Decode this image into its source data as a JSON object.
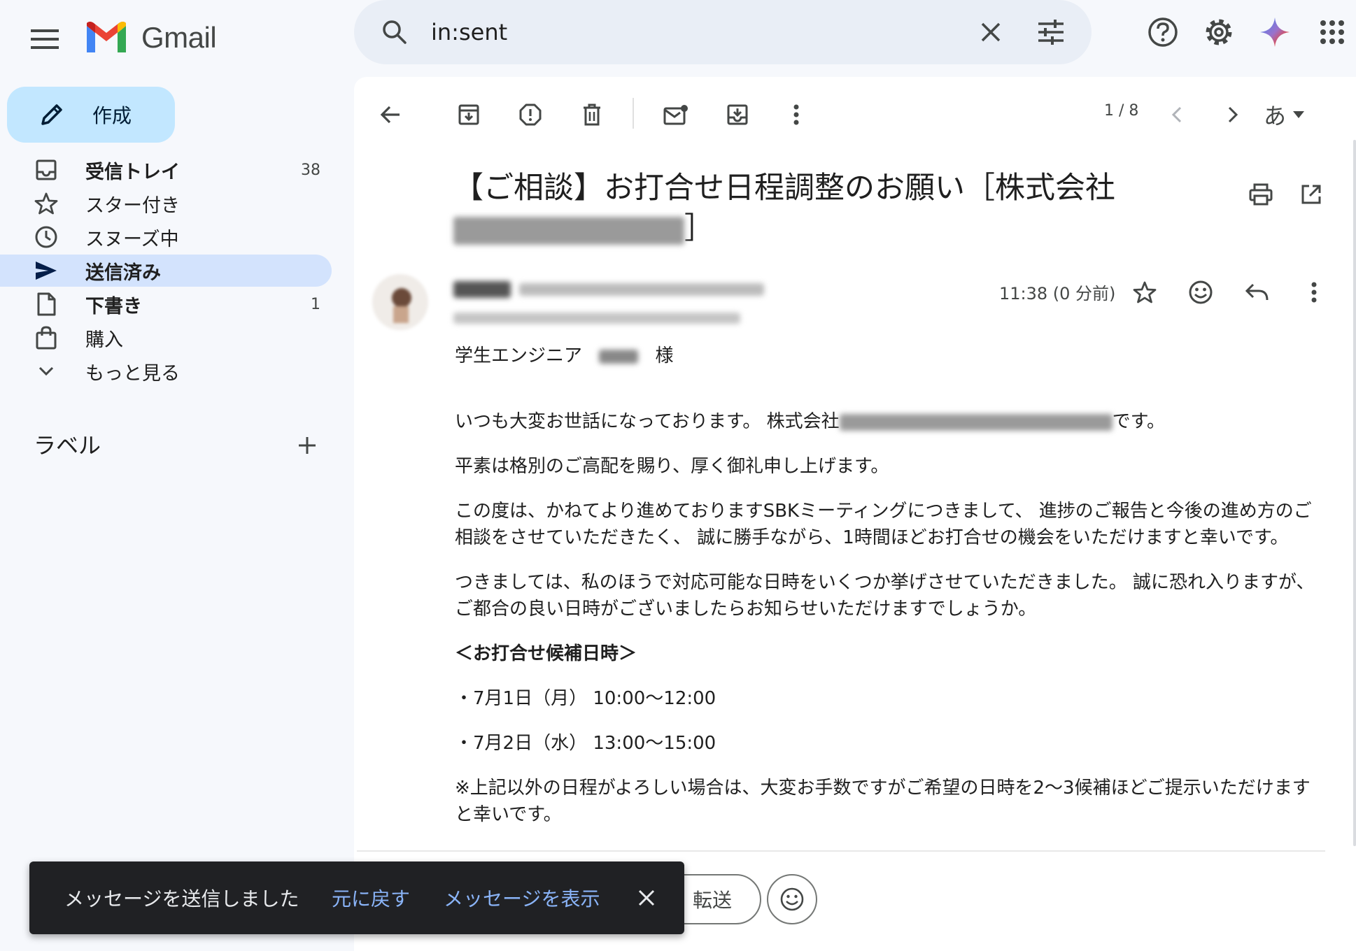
{
  "app": {
    "name": "Gmail"
  },
  "search": {
    "value": "in:sent"
  },
  "compose": {
    "label": "作成"
  },
  "sidebar": {
    "items": [
      {
        "label": "受信トレイ",
        "count": "38",
        "icon": "inbox-icon",
        "bold": true
      },
      {
        "label": "スター付き",
        "count": "",
        "icon": "star-icon",
        "bold": false
      },
      {
        "label": "スヌーズ中",
        "count": "",
        "icon": "clock-icon",
        "bold": false
      },
      {
        "label": "送信済み",
        "count": "",
        "icon": "send-icon",
        "bold": true,
        "active": true
      },
      {
        "label": "下書き",
        "count": "1",
        "icon": "draft-icon",
        "bold": true
      },
      {
        "label": "購入",
        "count": "",
        "icon": "shopping-bag-icon",
        "bold": false
      },
      {
        "label": "もっと見る",
        "count": "",
        "icon": "chevron-down-icon",
        "bold": false
      }
    ],
    "labels_title": "ラベル"
  },
  "toolbar": {
    "pager": "1 / 8",
    "lang": "あ"
  },
  "email": {
    "subject_line1": "【ご相談】お打合せ日程調整のお願い［株式会社",
    "subject_end": "］",
    "time": "11:38 (0 分前)",
    "salutation_prefix": "学生エンジニア",
    "salutation_suffix": "様",
    "greeting_prefix": "いつも大変お世話になっております。 株式会社",
    "greeting_suffix": "です。",
    "paragraphs": [
      "平素は格別のご高配を賜り、厚く御礼申し上げます。",
      "この度は、かねてより進めておりますSBKミーティングにつきまして、 進捗のご報告と今後の進め方のご相談をさせていただきたく、 誠に勝手ながら、1時間ほどお打合せの機会をいただけますと幸いです。",
      "つきましては、私のほうで対応可能な日時をいくつか挙げさせていただきました。 誠に恐れ入りますが、ご都合の良い日時がございましたらお知らせいただけますでしょうか。"
    ],
    "schedule_heading": "＜お打合せ候補日時＞",
    "slot1": "・7月1日（月） 10:00〜12:00",
    "slot2": "・7月2日（水） 13:00〜15:00",
    "note": "※上記以外の日程がよろしい場合は、大変お手数ですがご希望の日時を2〜3候補ほどご提示いただけますと幸いです。"
  },
  "reply": {
    "forward_label": "転送"
  },
  "snackbar": {
    "message": "メッセージを送信しました",
    "undo": "元に戻す",
    "view": "メッセージを表示"
  }
}
